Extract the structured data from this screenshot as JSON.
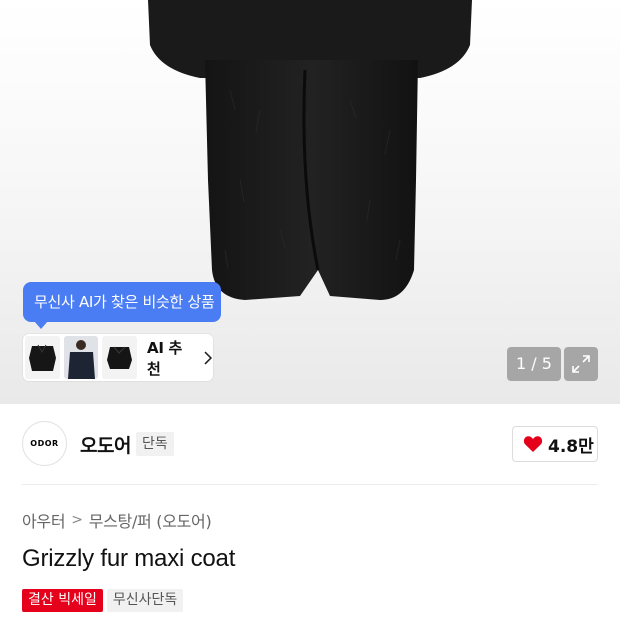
{
  "gallery": {
    "ai_tooltip": "무신사 AI가 찾은 비슷한 상품",
    "ai_recommend_label": "AI 추천",
    "ai_thumbnails": [
      "black-fur-jacket",
      "navy-coat-model",
      "black-shearling-jacket"
    ],
    "pager_text": "1 / 5",
    "expand_icon": "expand-icon"
  },
  "brand": {
    "logo_text": "ODOR",
    "name": "오도어",
    "badge": "단독",
    "like_count": "4.8만",
    "like_color": "#e5001c"
  },
  "product": {
    "breadcrumb": [
      "아우터",
      "무스탕/퍼 (오도어)"
    ],
    "breadcrumb_separator": ">",
    "title": "Grizzly fur maxi coat",
    "tags": [
      "결산 빅세일",
      "무신사단독"
    ],
    "sale_tag_color": "#e5001c"
  }
}
